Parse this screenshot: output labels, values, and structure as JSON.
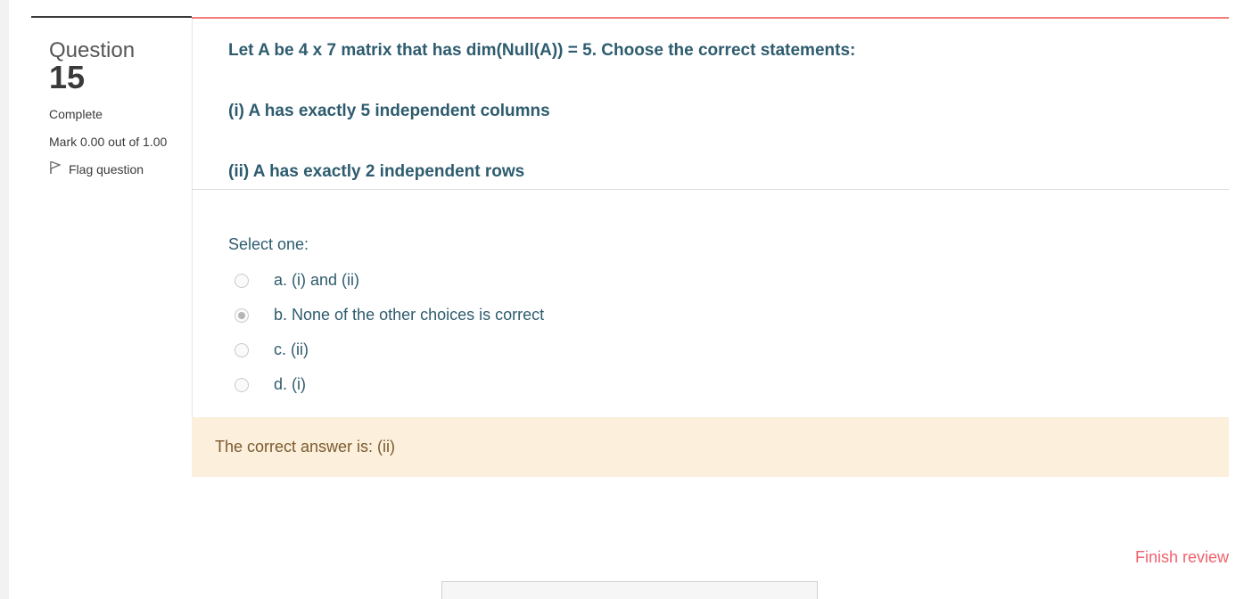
{
  "info": {
    "question_label": "Question",
    "question_number": "15",
    "state": "Complete",
    "grade": "Mark 0.00 out of 1.00",
    "flag_label": "Flag question"
  },
  "question": {
    "lines": [
      "Let A be 4 x 7 matrix that has dim(Null(A)) = 5. Choose the correct statements:",
      "(i) A has exactly 5 independent columns",
      "(ii) A has exactly 2 independent rows"
    ]
  },
  "answer": {
    "prompt": "Select one:",
    "options": [
      {
        "label": "a. (i) and (ii)",
        "checked": false
      },
      {
        "label": "b. None of the other choices is correct",
        "checked": true
      },
      {
        "label": "c. (ii)",
        "checked": false
      },
      {
        "label": "d. (i)",
        "checked": false
      }
    ]
  },
  "feedback": {
    "text": "The correct answer is: (ii)"
  },
  "navigation": {
    "finish_review_label": "Finish review"
  },
  "icons": {
    "flag": "flag-icon"
  },
  "colors": {
    "question_text": "#2e5c6e",
    "accent_line": "#f47c7c",
    "feedback_bg": "#fcefdc",
    "link": "#f0626e"
  }
}
